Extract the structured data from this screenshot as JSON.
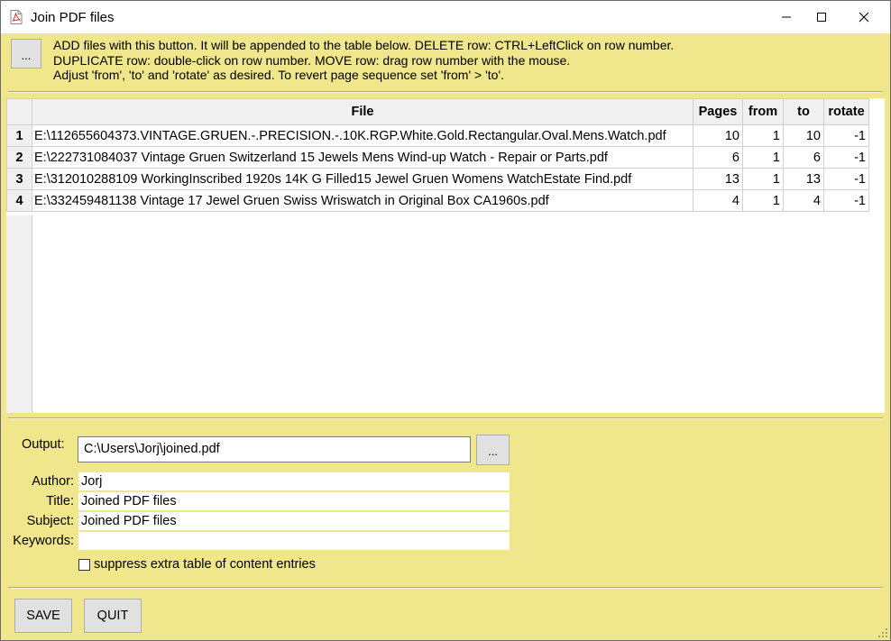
{
  "window": {
    "title": "Join PDF files",
    "icon": "pdf-file-icon",
    "controls": {
      "minimize": "minimize-icon",
      "maximize": "maximize-icon",
      "close": "close-icon"
    }
  },
  "toolbar": {
    "add_button_label": "...",
    "instructions": [
      "ADD files with this button. It will be appended to the table below. DELETE row: CTRL+LeftClick on row number.",
      "DUPLICATE row: double-click on row number. MOVE row: drag row number with the mouse.",
      "Adjust 'from', 'to' and 'rotate' as desired. To revert page sequence set 'from' > 'to'."
    ]
  },
  "table": {
    "columns": [
      "File",
      "Pages",
      "from",
      "to",
      "rotate"
    ],
    "rows": [
      {
        "num": "1",
        "file": "E:\\112655604373.VINTAGE.GRUEN.-.PRECISION.-.10K.RGP.White.Gold.Rectangular.Oval.Mens.Watch.pdf",
        "pages": "10",
        "from": "1",
        "to": "10",
        "rotate": "-1"
      },
      {
        "num": "2",
        "file": "E:\\222731084037 Vintage Gruen Switzerland 15 Jewels Mens Wind-up Watch - Repair or Parts.pdf",
        "pages": "6",
        "from": "1",
        "to": "6",
        "rotate": "-1"
      },
      {
        "num": "3",
        "file": "E:\\312010288109 WorkingInscribed 1920s 14K G Filled15 Jewel Gruen Womens WatchEstate Find.pdf",
        "pages": "13",
        "from": "1",
        "to": "13",
        "rotate": "-1"
      },
      {
        "num": "4",
        "file": "E:\\332459481138 Vintage 17 Jewel Gruen Swiss Wriswatch in Original Box CA1960s.pdf",
        "pages": "4",
        "from": "1",
        "to": "4",
        "rotate": "-1"
      }
    ]
  },
  "form": {
    "output_label": "Output:",
    "output_value": "C:\\Users\\Jorj\\joined.pdf",
    "browse_label": "...",
    "author_label": "Author:",
    "author_value": "Jorj",
    "title_label": "Title:",
    "title_value": "Joined PDF files",
    "subject_label": "Subject:",
    "subject_value": "Joined PDF files",
    "keywords_label": "Keywords:",
    "keywords_value": "",
    "suppress_label": "suppress extra table of content entries",
    "suppress_checked": false
  },
  "buttons": {
    "save": "SAVE",
    "quit": "QUIT"
  },
  "colors": {
    "panel": "#f0e68c",
    "table_bg": "#ffffff",
    "header_bg": "#f0f0f0",
    "button_bg": "#e1e1e1"
  }
}
